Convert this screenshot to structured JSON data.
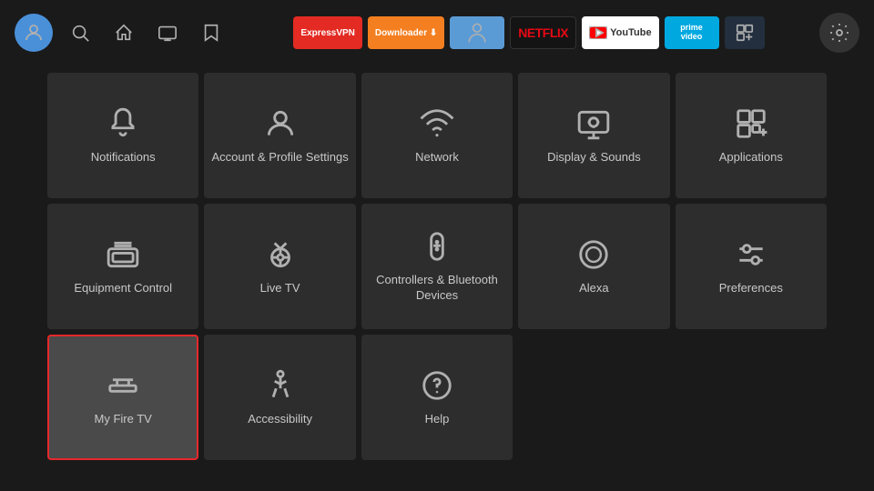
{
  "topbar": {
    "nav_icons": [
      "🔍",
      "🏠",
      "📺",
      "🔖"
    ],
    "apps": [
      {
        "label": "ExpressVPN",
        "class": "badge-expressvpn"
      },
      {
        "label": "Downloader",
        "class": "badge-downloader"
      },
      {
        "label": "↑",
        "class": "badge-toca"
      },
      {
        "label": "NETFLIX",
        "class": "badge-netflix"
      },
      {
        "label": "▶ YouTube",
        "class": "badge-youtube"
      },
      {
        "label": "prime video",
        "class": "badge-primevideo"
      }
    ]
  },
  "settings": {
    "tiles": [
      {
        "id": "notifications",
        "label": "Notifications"
      },
      {
        "id": "account",
        "label": "Account & Profile Settings"
      },
      {
        "id": "network",
        "label": "Network"
      },
      {
        "id": "display-sounds",
        "label": "Display & Sounds"
      },
      {
        "id": "applications",
        "label": "Applications"
      },
      {
        "id": "equipment",
        "label": "Equipment Control"
      },
      {
        "id": "live-tv",
        "label": "Live TV"
      },
      {
        "id": "controllers",
        "label": "Controllers & Bluetooth Devices"
      },
      {
        "id": "alexa",
        "label": "Alexa"
      },
      {
        "id": "preferences",
        "label": "Preferences"
      },
      {
        "id": "my-fire-tv",
        "label": "My Fire TV",
        "selected": true
      },
      {
        "id": "accessibility",
        "label": "Accessibility"
      },
      {
        "id": "help",
        "label": "Help"
      }
    ]
  }
}
